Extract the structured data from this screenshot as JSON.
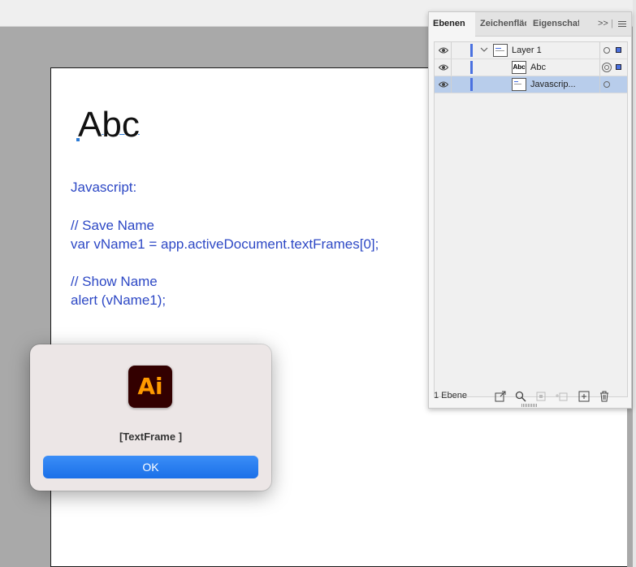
{
  "document": {
    "heading_text": "Abc",
    "code_lines": [
      "Javascript:",
      "// Save Name",
      "var vName1 = app.activeDocument.textFrames[0];",
      "// Show Name",
      "alert (vName1);"
    ]
  },
  "layers_panel": {
    "tabs": [
      {
        "label": "Ebenen",
        "active": true
      },
      {
        "label": "Zeichenfläc",
        "active": false
      },
      {
        "label": "Eigenschaft",
        "active": false
      }
    ],
    "overflow_label": ">>",
    "menu_icon": "hamburger-menu-icon",
    "rows": [
      {
        "name": "Layer 1",
        "thumb": "",
        "selected": false
      },
      {
        "name": "Abc",
        "thumb": "Abc",
        "selected": false
      },
      {
        "name": "Javascrip...",
        "thumb": "",
        "selected": true
      }
    ],
    "footer_label": "1 Ebene",
    "accent_color": "#4a71e0"
  },
  "dialog": {
    "icon_text": "Ai",
    "message": "[TextFrame ]",
    "ok_label": "OK",
    "button_color": "#1a6fe8"
  }
}
